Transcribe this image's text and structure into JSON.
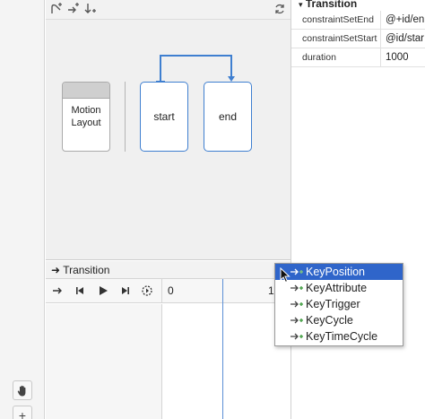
{
  "colors": {
    "accent": "#3f7fd0",
    "selection": "#2f65ca",
    "playhead": "#5b8fd6"
  },
  "toolbar": {
    "icons": [
      "create-constraint-set-icon",
      "create-transition-icon",
      "create-click-handler-icon",
      "cycle-layout-icon"
    ]
  },
  "canvas": {
    "motion_layout_card": {
      "line1": "Motion",
      "line2": "Layout"
    },
    "constraint_sets": [
      {
        "label": "start"
      },
      {
        "label": "end"
      }
    ]
  },
  "attributes_panel": {
    "header": "Transition",
    "rows": [
      {
        "key": "constraintSetEnd",
        "value": "@+id/en"
      },
      {
        "key": "constraintSetStart",
        "value": "@id/star"
      },
      {
        "key": "duration",
        "value": "1000"
      }
    ]
  },
  "timeline": {
    "header": "Transition",
    "ruler": {
      "start": "0",
      "end": "1"
    }
  },
  "add_keyframe_menu": {
    "items": [
      {
        "label": "KeyPosition",
        "selected": true
      },
      {
        "label": "KeyAttribute",
        "selected": false
      },
      {
        "label": "KeyTrigger",
        "selected": false
      },
      {
        "label": "KeyCycle",
        "selected": false
      },
      {
        "label": "KeyTimeCycle",
        "selected": false
      }
    ]
  },
  "left_tools": {
    "pan": "pan-hand-icon",
    "zoom_in": "+"
  }
}
